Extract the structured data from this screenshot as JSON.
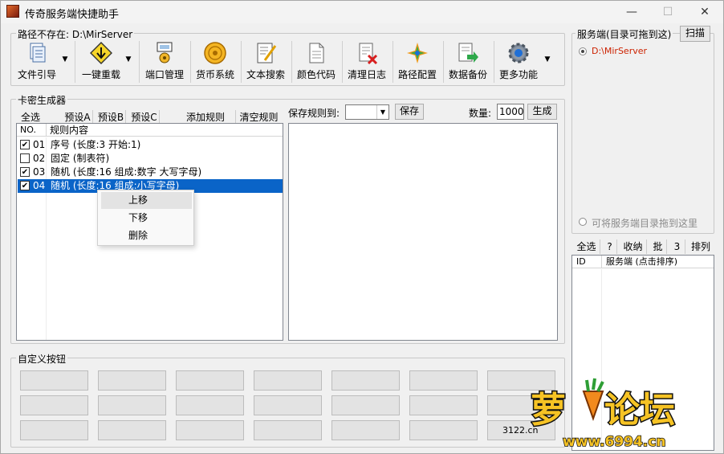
{
  "window": {
    "title": "传奇服务端快捷助手",
    "minimize": "—",
    "maximize": "☐",
    "close": "✕"
  },
  "toolbar_group": {
    "label": "路径不存在: D:\\MirServer"
  },
  "toolbar": [
    {
      "label": "文件引导",
      "icon": "file-icon",
      "has_dropdown": true
    },
    {
      "label": "一键重载",
      "icon": "reload-icon",
      "has_dropdown": true
    },
    {
      "label": "端口管理",
      "icon": "port-icon"
    },
    {
      "label": "货币系统",
      "icon": "coin-icon"
    },
    {
      "label": "文本搜索",
      "icon": "text-search-icon"
    },
    {
      "label": "颜色代码",
      "icon": "color-code-icon"
    },
    {
      "label": "清理日志",
      "icon": "clear-log-icon"
    },
    {
      "label": "路径配置",
      "icon": "path-config-icon"
    },
    {
      "label": "数据备份",
      "icon": "backup-icon"
    },
    {
      "label": "更多功能",
      "icon": "gear-icon",
      "has_dropdown": true
    }
  ],
  "card_group": {
    "label": "卡密生成器"
  },
  "card_buttons": {
    "select_all": "全选",
    "preset_a": "预设A",
    "preset_b": "预设B",
    "preset_c": "预设C",
    "add_rule": "添加规则",
    "clear_rules": "清空规则"
  },
  "rules_table": {
    "col_no": "NO.",
    "col_content": "规则内容",
    "rows": [
      {
        "checked": true,
        "no": "01",
        "content": "序号 (长度:3  开始:1)"
      },
      {
        "checked": false,
        "no": "02",
        "content": "固定 (制表符)"
      },
      {
        "checked": true,
        "no": "03",
        "content": "随机 (长度:16  组成:数字 大写字母)"
      },
      {
        "checked": true,
        "no": "04",
        "content": "随机 (长度:16  组成:小写字母)",
        "selected": true
      }
    ]
  },
  "context_menu": {
    "move_up": "上移",
    "move_down": "下移",
    "delete": "删除"
  },
  "save_controls": {
    "save_rule_label": "保存规则到:",
    "save_button": "保存",
    "quantity_label": "数量:",
    "quantity_value": "1000",
    "generate_button": "生成"
  },
  "custom_group": {
    "label": "自定义按钮"
  },
  "server_group": {
    "label": "服务端(目录可拖到这)",
    "scan_button": "扫描",
    "server_path": "D:\\MirServer",
    "drag_hint": "可将服务端目录拖到这里"
  },
  "server_list": {
    "select_all": "全选",
    "help": "?",
    "collapse": "收纳",
    "batch": "批",
    "count": "3",
    "sort": "排列",
    "col_id": "ID",
    "col_server": "服务端 (点击排序)"
  },
  "watermark": {
    "text": "萝卜论坛",
    "url": "www.6994.cn",
    "small": "3122.cn"
  },
  "colors": {
    "selection": "#0a64c8",
    "accent_orange": "#f28a1e",
    "path_red": "#cc2200"
  }
}
